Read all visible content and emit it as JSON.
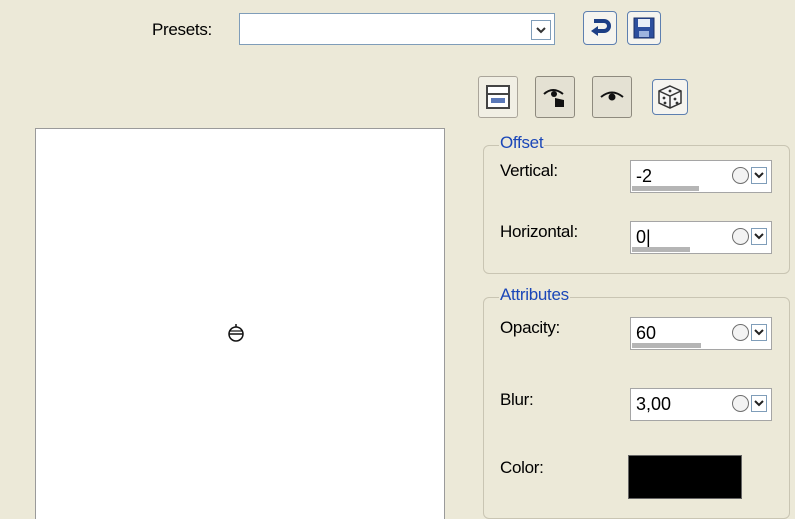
{
  "presets": {
    "label": "Presets:",
    "value": ""
  },
  "offset": {
    "title": "Offset",
    "vertical": {
      "label": "Vertical:",
      "value": "-2",
      "fill": 0.58
    },
    "horizontal": {
      "label": "Horizontal:",
      "value": "0|",
      "fill": 0.5
    }
  },
  "attributes": {
    "title": "Attributes",
    "opacity": {
      "label": "Opacity:",
      "value": "60",
      "fill": 0.6
    },
    "blur": {
      "label": "Blur:",
      "value": "3,00",
      "fill": 0
    },
    "color": {
      "label": "Color:",
      "value": "#000000"
    }
  },
  "icons": {
    "reset": "reset-arrow-icon",
    "save": "floppy-save-icon",
    "dialog": "dialog-layout-icon",
    "preview_on_image": "eye-hand-icon",
    "preview": "eye-icon",
    "randomize": "dice-icon",
    "target": "target-crosshair-icon"
  }
}
